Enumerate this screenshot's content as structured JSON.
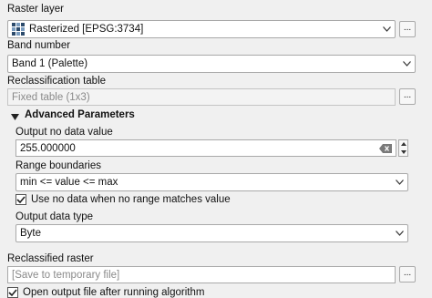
{
  "raster_layer": {
    "label": "Raster layer",
    "value": "Rasterized [EPSG:3734]",
    "layer_icon": "raster-layer-icon"
  },
  "band_number": {
    "label": "Band number",
    "value": "Band 1 (Palette)"
  },
  "reclassification_table": {
    "label": "Reclassification table",
    "value": "Fixed table (1x3)",
    "button": "..."
  },
  "advanced": {
    "title": "Advanced Parameters",
    "output_no_data": {
      "label": "Output no data value",
      "value": "255.000000"
    },
    "range_boundaries": {
      "label": "Range boundaries",
      "value": "min <= value <= max"
    },
    "use_no_data": {
      "label": "Use no data when no range matches value",
      "checked": true
    },
    "output_data_type": {
      "label": "Output data type",
      "value": "Byte"
    }
  },
  "reclassified_raster": {
    "label": "Reclassified raster",
    "placeholder": "[Save to temporary file]",
    "button": "..."
  },
  "open_output": {
    "label": "Open output file after running algorithm",
    "checked": true
  }
}
